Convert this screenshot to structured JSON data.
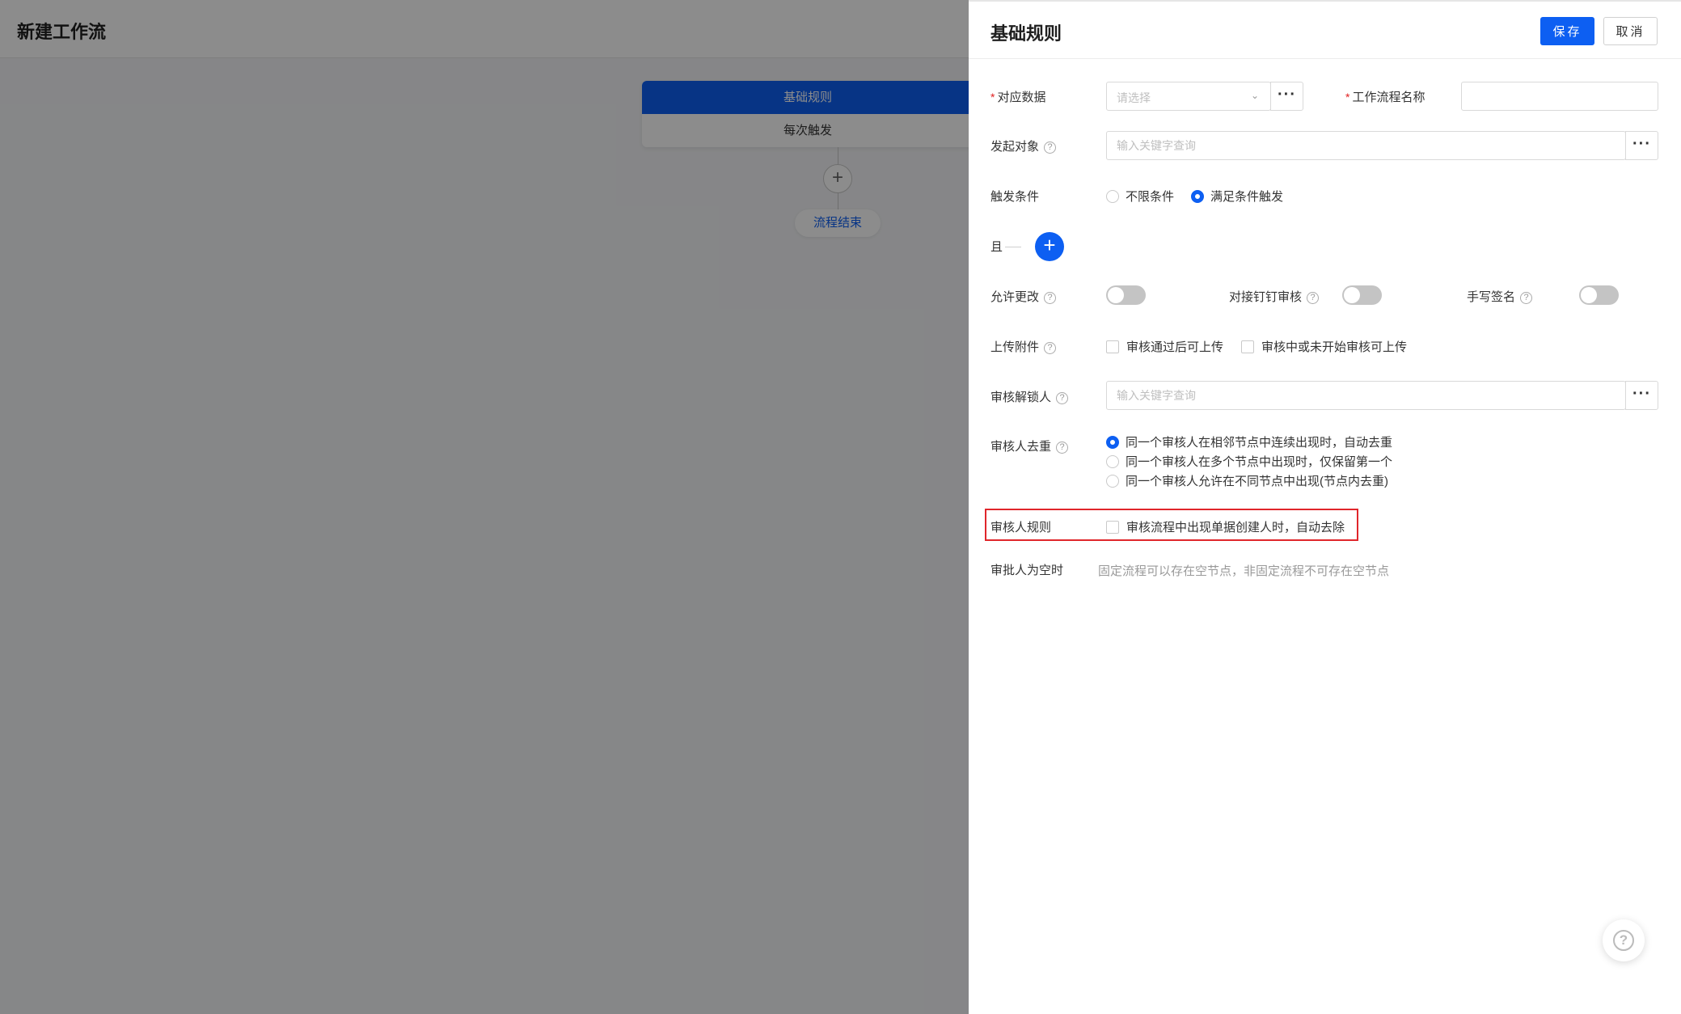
{
  "page": {
    "title": "新建工作流"
  },
  "flow": {
    "node_header": "基础规则",
    "node_body": "每次触发",
    "add_symbol": "+",
    "end_label": "流程结束"
  },
  "drawer": {
    "title": "基础规则",
    "save_label": "保存",
    "cancel_label": "取消",
    "more_symbol": "···",
    "help_symbol": "?",
    "fields": {
      "data": {
        "required_mark": "*",
        "label": "对应数据",
        "placeholder": "请选择"
      },
      "workflow_name": {
        "required_mark": "*",
        "label": "工作流程名称",
        "value": ""
      },
      "initiator": {
        "label": "发起对象",
        "placeholder": "输入关键字查询"
      },
      "trigger": {
        "label": "触发条件",
        "options": [
          "不限条件",
          "满足条件触发"
        ],
        "selected": "满足条件触发"
      },
      "and_label": "且",
      "allow_edit": {
        "label": "允许更改",
        "on": false
      },
      "dingtalk": {
        "label": "对接钉钉审核",
        "on": false
      },
      "signature": {
        "label": "手写签名",
        "on": false
      },
      "attachment": {
        "label": "上传附件",
        "options": [
          "审核通过后可上传",
          "审核中或未开始审核可上传"
        ]
      },
      "unlocker": {
        "label": "审核解锁人",
        "placeholder": "输入关键字查询"
      },
      "dedupe": {
        "label": "审核人去重",
        "options": [
          "同一个审核人在相邻节点中连续出现时，自动去重",
          "同一个审核人在多个节点中出现时，仅保留第一个",
          "同一个审核人允许在不同节点中出现(节点内去重)"
        ],
        "selected_index": 0
      },
      "reviewer_rule": {
        "label": "审核人规则",
        "option": "审核流程中出现单据创建人时，自动去除"
      },
      "empty_approver": {
        "label": "审批人为空时",
        "hint": "固定流程可以存在空节点，非固定流程不可存在空节点"
      }
    }
  },
  "colors": {
    "primary": "#0d5ff2",
    "highlight": "#e0262b",
    "required": "#e02020"
  }
}
